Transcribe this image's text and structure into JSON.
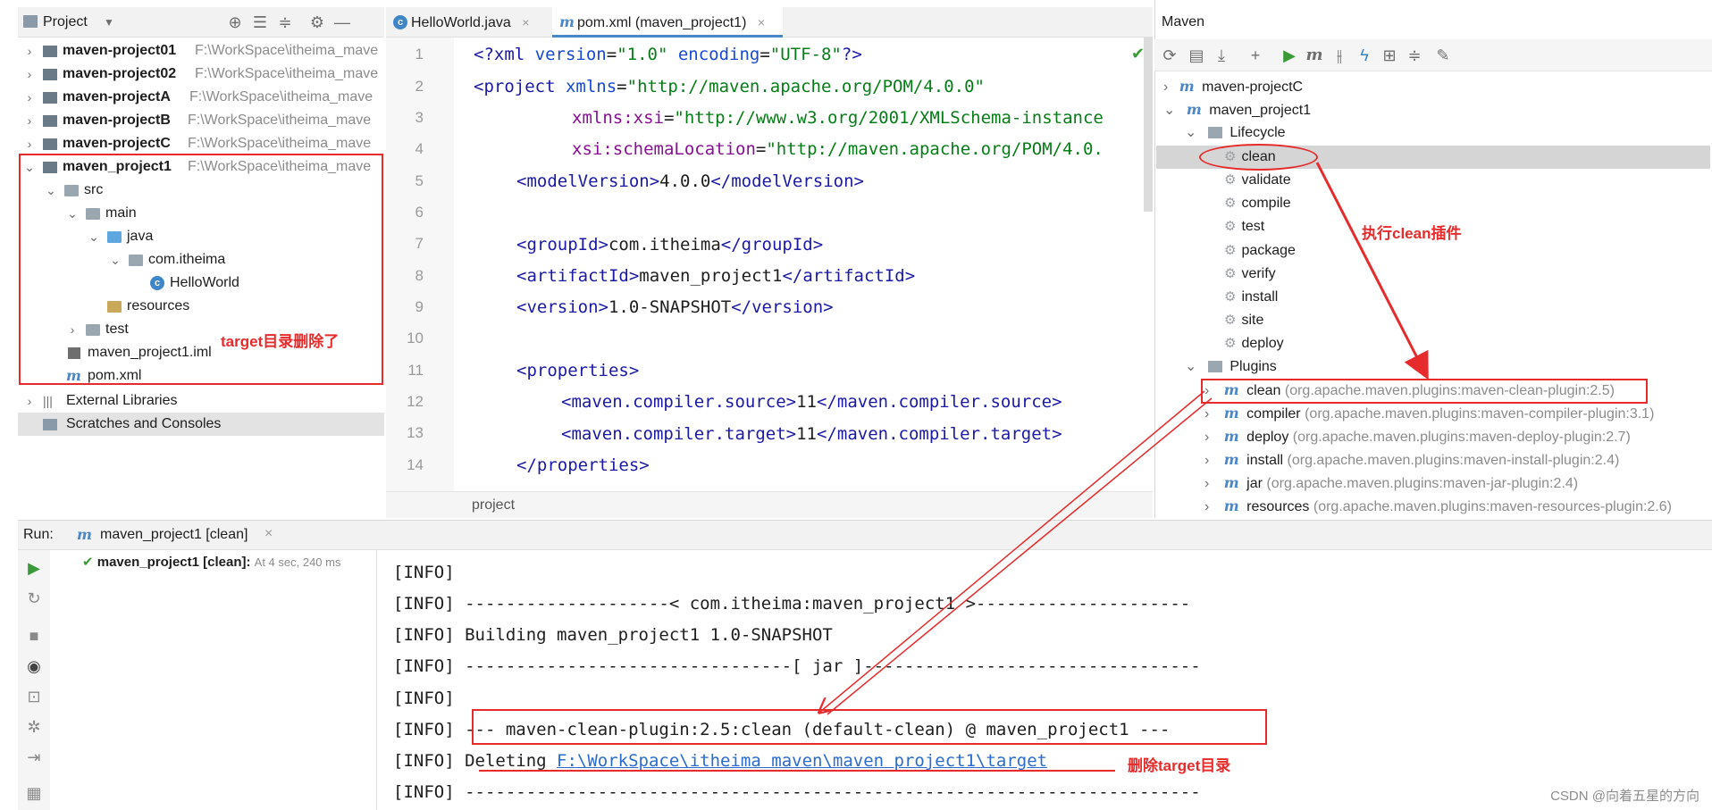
{
  "project": {
    "header": {
      "title": "Project"
    },
    "tree": [
      {
        "label": "maven-project01",
        "path": "F:\\WorkSpace\\itheima_mave"
      },
      {
        "label": "maven-project02",
        "path": "F:\\WorkSpace\\itheima_mave"
      },
      {
        "label": "maven-projectA",
        "path": "F:\\WorkSpace\\itheima_mave"
      },
      {
        "label": "maven-projectB",
        "path": "F:\\WorkSpace\\itheima_mave"
      },
      {
        "label": "maven-projectC",
        "path": "F:\\WorkSpace\\itheima_mave"
      },
      {
        "label": "maven_project1",
        "path": "F:\\WorkSpace\\itheima_mave"
      }
    ],
    "src": "src",
    "main": "main",
    "java": "java",
    "pkg": "com.itheima",
    "cls": "HelloWorld",
    "resources": "resources",
    "test": "test",
    "iml": "maven_project1.iml",
    "pom": "pom.xml",
    "ext_libs": "External Libraries",
    "scratches": "Scratches and Consoles"
  },
  "editor": {
    "tabs": [
      {
        "label": "HelloWorld.java"
      },
      {
        "label": "pom.xml (maven_project1)"
      }
    ],
    "line_numbers": [
      "1",
      "2",
      "3",
      "4",
      "5",
      "6",
      "7",
      "8",
      "9",
      "10",
      "11",
      "12",
      "13",
      "14"
    ],
    "footer": "project"
  },
  "code": {
    "l1_a": "<?",
    "l1_b": "xml ",
    "l1_c": "version",
    "l1_d": "=",
    "l1_e": "\"1.0\"",
    "l1_f": " encoding",
    "l1_g": "=",
    "l1_h": "\"UTF-8\"",
    "l1_i": "?>",
    "l2_a": "<",
    "l2_b": "project ",
    "l2_c": "xmlns",
    "l2_d": "=",
    "l2_e": "\"http://maven.apache.org/POM/4.0.0\"",
    "l3_a": "xmlns:xsi",
    "l3_b": "=",
    "l3_c": "\"http://www.w3.org/2001/XMLSchema-instance",
    "l4_a": "xsi:schemaLocation",
    "l4_b": "=",
    "l4_c": "\"http://maven.apache.org/POM/4.0.",
    "l5_a": "<modelVersion>",
    "l5_b": "4.0.0",
    "l5_c": "</modelVersion>",
    "l7_a": "<groupId>",
    "l7_b": "com.itheima",
    "l7_c": "</groupId>",
    "l8_a": "<artifactId>",
    "l8_b": "maven_project1",
    "l8_c": "</artifactId>",
    "l9_a": "<version>",
    "l9_b": "1.0-SNAPSHOT",
    "l9_c": "</version>",
    "l11": "<properties>",
    "l12_a": "<maven.compiler.source>",
    "l12_b": "11",
    "l12_c": "</maven.compiler.source>",
    "l13_a": "<maven.compiler.target>",
    "l13_b": "11",
    "l13_c": "</maven.compiler.target>",
    "l14": "</properties>"
  },
  "maven": {
    "title": "Maven",
    "projects": [
      "maven-projectC",
      "maven_project1"
    ],
    "lifecycle_label": "Lifecycle",
    "lifecycle": [
      "clean",
      "validate",
      "compile",
      "test",
      "package",
      "verify",
      "install",
      "site",
      "deploy"
    ],
    "plugins_label": "Plugins",
    "plugins": [
      {
        "name": "clean",
        "coord": "(org.apache.maven.plugins:maven-clean-plugin:2.5)"
      },
      {
        "name": "compiler",
        "coord": "(org.apache.maven.plugins:maven-compiler-plugin:3.1)"
      },
      {
        "name": "deploy",
        "coord": "(org.apache.maven.plugins:maven-deploy-plugin:2.7)"
      },
      {
        "name": "install",
        "coord": "(org.apache.maven.plugins:maven-install-plugin:2.4)"
      },
      {
        "name": "jar",
        "coord": "(org.apache.maven.plugins:maven-jar-plugin:2.4)"
      },
      {
        "name": "resources",
        "coord": "(org.apache.maven.plugins:maven-resources-plugin:2.6)"
      }
    ]
  },
  "run": {
    "label": "Run:",
    "tab": "maven_project1 [clean]",
    "result_title": "maven_project1 [clean]:",
    "result_time": "At 4 sec, 240 ms",
    "lines": [
      "[INFO]",
      "[INFO] --------------------< com.itheima:maven_project1 >---------------------",
      "[INFO] Building maven_project1 1.0-SNAPSHOT",
      "[INFO] --------------------------------[ jar ]---------------------------------",
      "[INFO]",
      "[INFO] --- maven-clean-plugin:2.5:clean (default-clean) @ maven_project1 ---",
      "[INFO] Deleting ",
      "[INFO] ------------------------------------------------------------------------"
    ],
    "delete_path": "F:\\WorkSpace\\itheima_maven\\maven_project1\\target"
  },
  "annotations": {
    "target_deleted": "target目录删除了",
    "exec_clean": "执行clean插件",
    "delete_target": "删除target目录",
    "watermark": "CSDN @向着五星的方向"
  }
}
